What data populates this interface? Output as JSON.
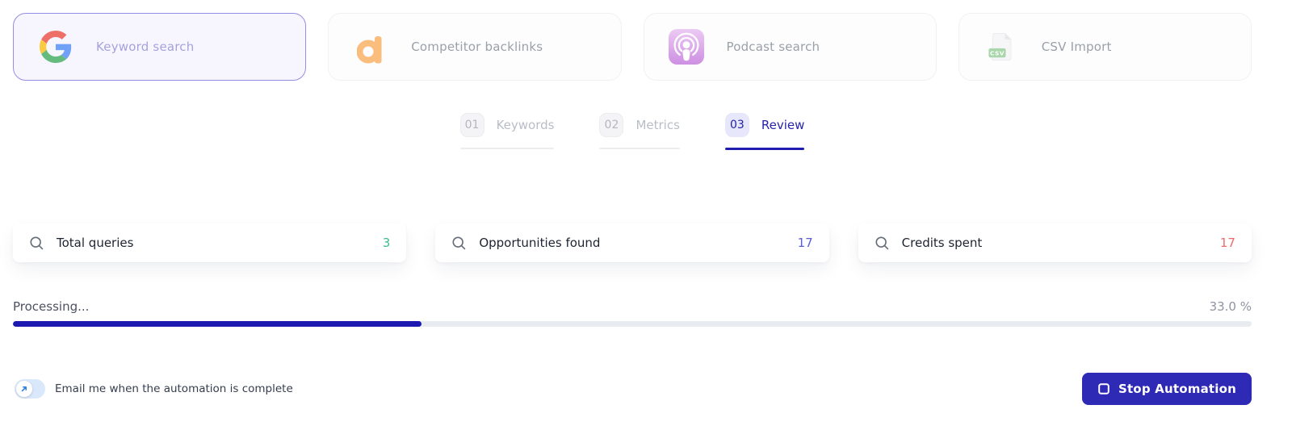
{
  "colors": {
    "primary": "#2e2ab5",
    "progress_fill": "#1d18b0",
    "selected_card_border": "#948de4"
  },
  "sources": {
    "items": [
      {
        "label": "Keyword search",
        "icon": "google-logo",
        "selected": true
      },
      {
        "label": "Competitor backlinks",
        "icon": "ahrefs-logo",
        "selected": false
      },
      {
        "label": "Podcast search",
        "icon": "apple-podcasts-logo",
        "selected": false
      },
      {
        "label": "CSV Import",
        "icon": "csv-file",
        "selected": false
      }
    ]
  },
  "steps": [
    {
      "number": "01",
      "label": "Keywords",
      "active": false
    },
    {
      "number": "02",
      "label": "Metrics",
      "active": false
    },
    {
      "number": "03",
      "label": "Review",
      "active": true
    }
  ],
  "stats": [
    {
      "label": "Total queries",
      "value": "3",
      "color": "#3dbd8c",
      "icon": "search-icon"
    },
    {
      "label": "Opportunities found",
      "value": "17",
      "color": "#5a5fd8",
      "icon": "search-icon"
    },
    {
      "label": "Credits spent",
      "value": "17",
      "color": "#ee6a6a",
      "icon": "search-icon"
    }
  ],
  "progress": {
    "label": "Processing...",
    "percent": 33,
    "percent_label": "33.0 %"
  },
  "footer": {
    "toggle_label": "Email me when the automation is complete",
    "toggle_on": false,
    "stop_button_label": "Stop Automation"
  }
}
